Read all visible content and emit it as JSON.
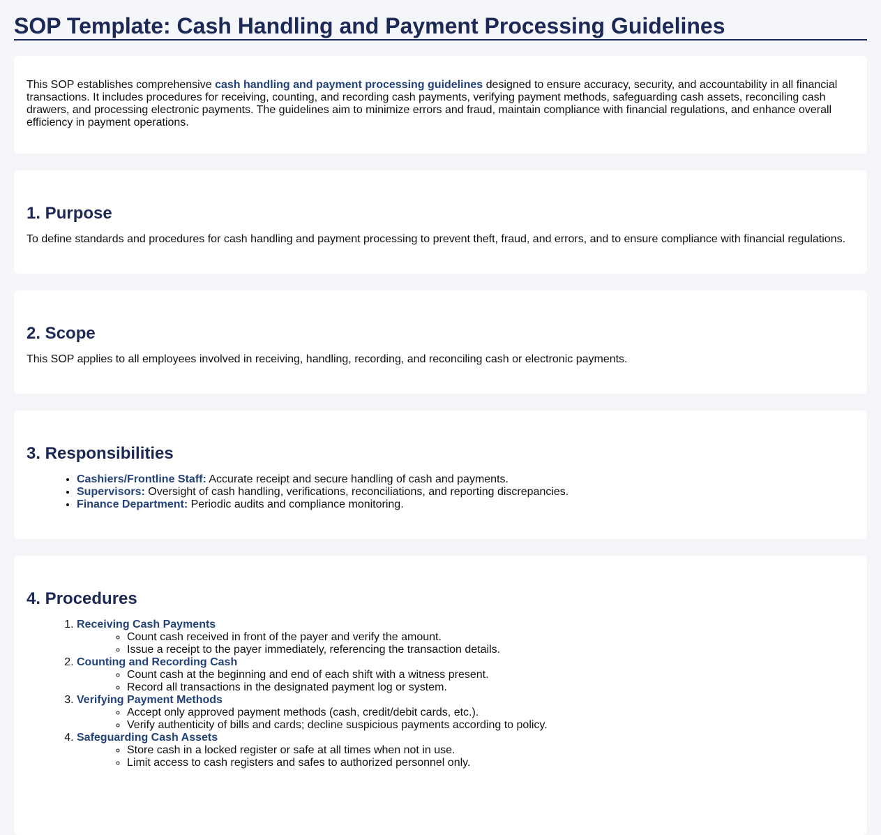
{
  "title": "SOP Template: Cash Handling and Payment Processing Guidelines",
  "intro": {
    "before": "This SOP establishes comprehensive ",
    "highlight": "cash handling and payment processing guidelines",
    "after": " designed to ensure accuracy, security, and accountability in all financial transactions. It includes procedures for receiving, counting, and recording cash payments, verifying payment methods, safeguarding cash assets, reconciling cash drawers, and processing electronic payments. The guidelines aim to minimize errors and fraud, maintain compliance with financial regulations, and enhance overall efficiency in payment operations."
  },
  "purpose": {
    "heading": "1. Purpose",
    "text": "To define standards and procedures for cash handling and payment processing to prevent theft, fraud, and errors, and to ensure compliance with financial regulations."
  },
  "scope": {
    "heading": "2. Scope",
    "text": "This SOP applies to all employees involved in receiving, handling, recording, and reconciling cash or electronic payments."
  },
  "responsibilities": {
    "heading": "3. Responsibilities",
    "items": [
      {
        "role": "Cashiers/Frontline Staff:",
        "text": " Accurate receipt and secure handling of cash and payments."
      },
      {
        "role": "Supervisors:",
        "text": " Oversight of cash handling, verifications, reconciliations, and reporting discrepancies."
      },
      {
        "role": "Finance Department:",
        "text": " Periodic audits and compliance monitoring."
      }
    ]
  },
  "procedures": {
    "heading": "4. Procedures",
    "items": [
      {
        "title": "Receiving Cash Payments",
        "steps": [
          "Count cash received in front of the payer and verify the amount.",
          "Issue a receipt to the payer immediately, referencing the transaction details."
        ]
      },
      {
        "title": "Counting and Recording Cash",
        "steps": [
          "Count cash at the beginning and end of each shift with a witness present.",
          "Record all transactions in the designated payment log or system."
        ]
      },
      {
        "title": "Verifying Payment Methods",
        "steps": [
          "Accept only approved payment methods (cash, credit/debit cards, etc.).",
          "Verify authenticity of bills and cards; decline suspicious payments according to policy."
        ]
      },
      {
        "title": "Safeguarding Cash Assets",
        "steps": [
          "Store cash in a locked register or safe at all times when not in use.",
          "Limit access to cash registers and safes to authorized personnel only."
        ]
      }
    ]
  }
}
